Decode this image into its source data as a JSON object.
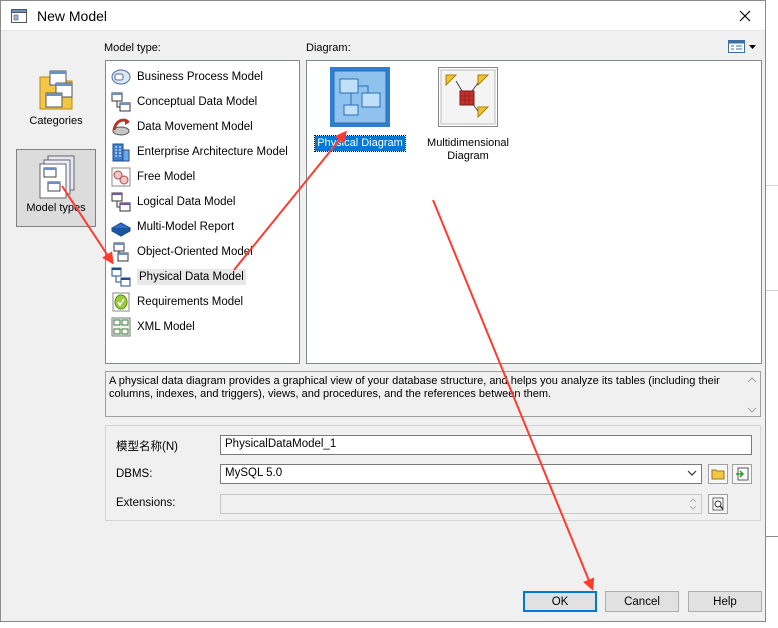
{
  "window": {
    "title": "New Model"
  },
  "categories": [
    {
      "label": "Categories",
      "selected": false
    },
    {
      "label": "Model types",
      "selected": true
    }
  ],
  "labels": {
    "model_type": "Model type:",
    "diagram": "Diagram:"
  },
  "model_types": [
    {
      "label": "Business Process Model",
      "icon": "business-process-icon"
    },
    {
      "label": "Conceptual Data Model",
      "icon": "conceptual-data-icon"
    },
    {
      "label": "Data Movement Model",
      "icon": "data-movement-icon"
    },
    {
      "label": "Enterprise Architecture Model",
      "icon": "enterprise-architecture-icon"
    },
    {
      "label": "Free Model",
      "icon": "free-model-icon"
    },
    {
      "label": "Logical Data Model",
      "icon": "logical-data-icon"
    },
    {
      "label": "Multi-Model Report",
      "icon": "report-icon"
    },
    {
      "label": "Object-Oriented Model",
      "icon": "object-oriented-icon"
    },
    {
      "label": "Physical Data Model",
      "icon": "physical-data-icon",
      "selected": true
    },
    {
      "label": "Requirements Model",
      "icon": "requirements-icon"
    },
    {
      "label": "XML Model",
      "icon": "xml-model-icon"
    }
  ],
  "diagrams": [
    {
      "label": "Physical Diagram",
      "icon": "physical-diagram-icon",
      "selected": true
    },
    {
      "label": "Multidimensional Diagram",
      "icon": "multidimensional-diagram-icon",
      "selected": false
    }
  ],
  "description": "A physical data diagram provides a graphical view of your database structure, and helps you analyze its tables (including their columns, indexes, and triggers), views, and procedures, and the references between them.",
  "form": {
    "model_name_label": "模型名称(N)",
    "model_name_value": "PhysicalDataModel_1",
    "dbms_label": "DBMS:",
    "dbms_value": "MySQL 5.0",
    "extensions_label": "Extensions:",
    "extensions_value": ""
  },
  "buttons": {
    "ok": "OK",
    "cancel": "Cancel",
    "help": "Help"
  },
  "colors": {
    "accent": "#0078d7",
    "annotation": "#ff3b30"
  }
}
